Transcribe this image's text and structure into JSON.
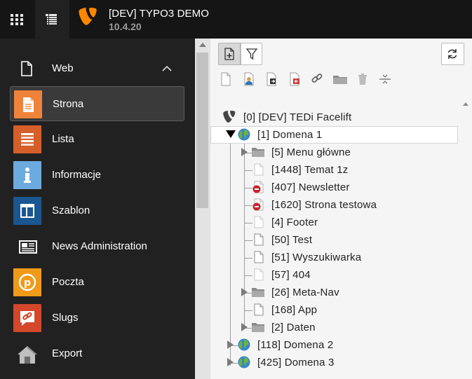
{
  "topbar": {
    "site_name": "[DEV] TYPO3 DEMO",
    "version": "10.4.20",
    "grid_icon": "module-grid-icon",
    "list_icon": "module-list-icon",
    "logo_icon": "typo3-logo"
  },
  "modmenu": {
    "group": {
      "label": "Web",
      "icon": "page-icon",
      "chevron": "chevron-up-icon"
    },
    "items": [
      {
        "label": "Strona",
        "icon": "page-module-icon",
        "color": "#f0833a",
        "active": true
      },
      {
        "label": "Lista",
        "icon": "list-module-icon",
        "color": "#d55f2a",
        "active": false
      },
      {
        "label": "Informacje",
        "icon": "info-module-icon",
        "color": "#6daae0",
        "active": false
      },
      {
        "label": "Szablon",
        "icon": "template-module-icon",
        "color": "#1a568f",
        "active": false
      },
      {
        "label": "News Administration",
        "icon": "news-module-icon",
        "color": "#212121",
        "active": false
      },
      {
        "label": "Poczta",
        "icon": "mail-module-icon",
        "color": "#f09a1a",
        "active": false
      },
      {
        "label": "Slugs",
        "icon": "slugs-module-icon",
        "color": "#d4472b",
        "active": false
      },
      {
        "label": "Export",
        "icon": "export-module-icon",
        "color": "#212121",
        "active": false
      }
    ]
  },
  "tree": {
    "root": {
      "label": "[0] [DEV] TEDi Facelift"
    },
    "nodes": [
      {
        "label": "[1] Domena 1",
        "type": "site",
        "level": 1,
        "toggle": "open",
        "selected": true
      },
      {
        "label": "[5] Menu główne",
        "type": "folder",
        "level": 2,
        "toggle": "closed"
      },
      {
        "label": "[1448] Temat 1z",
        "type": "page-hidden",
        "level": 2,
        "toggle": "none"
      },
      {
        "label": "[407] Newsletter",
        "type": "page-restricted",
        "level": 2,
        "toggle": "none"
      },
      {
        "label": "[1620] Strona testowa",
        "type": "page-restricted",
        "level": 2,
        "toggle": "none"
      },
      {
        "label": "[4] Footer",
        "type": "page-hidden",
        "level": 2,
        "toggle": "none"
      },
      {
        "label": "[50] Test",
        "type": "page",
        "level": 2,
        "toggle": "none"
      },
      {
        "label": "[51] Wyszukiwarka",
        "type": "page",
        "level": 2,
        "toggle": "none"
      },
      {
        "label": "[57] 404",
        "type": "page-hidden",
        "level": 2,
        "toggle": "none"
      },
      {
        "label": "[26] Meta-Nav",
        "type": "folder",
        "level": 2,
        "toggle": "closed"
      },
      {
        "label": "[168] App",
        "type": "page",
        "level": 2,
        "toggle": "none"
      },
      {
        "label": "[2] Daten",
        "type": "folder",
        "level": 2,
        "toggle": "closed"
      },
      {
        "label": "[118] Domena 2",
        "type": "site",
        "level": 1,
        "toggle": "closed"
      },
      {
        "label": "[425] Domena 3",
        "type": "site",
        "level": 1,
        "toggle": "closed"
      }
    ]
  },
  "tree_toolbar": {
    "buttons": [
      "new-page-icon",
      "filter-icon",
      "refresh-icon"
    ],
    "drag_items": [
      "doktype-page-icon",
      "doktype-backend-user-section-icon",
      "doktype-shortcut-icon",
      "doktype-mountpoint-icon",
      "doktype-link-icon",
      "doktype-folder-icon",
      "doktype-recycler-icon",
      "doktype-spacer-icon"
    ]
  },
  "colors": {
    "topbar": "#151515",
    "sidebar": "#212121",
    "accent": "#ff8700"
  }
}
